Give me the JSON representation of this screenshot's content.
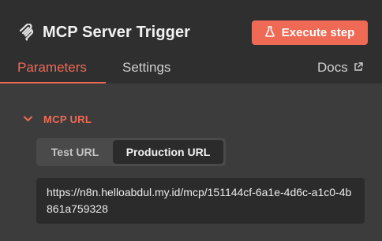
{
  "node": {
    "title": "MCP Server Trigger",
    "icon": "mcp-plug-icon"
  },
  "actions": {
    "execute_label": "Execute step",
    "execute_icon": "flask-icon"
  },
  "tabs": [
    {
      "label": "Parameters",
      "active": true
    },
    {
      "label": "Settings",
      "active": false
    }
  ],
  "docs": {
    "label": "Docs",
    "icon": "external-link-icon"
  },
  "mcp_url_section": {
    "title": "MCP URL",
    "expanded": true,
    "toggle": {
      "options": [
        "Test URL",
        "Production URL"
      ],
      "selected": "Production URL"
    },
    "url": "https://n8n.helloabdul.my.id/mcp/151144cf-6a1e-4d6c-a1c0-4b861a759328"
  },
  "colors": {
    "accent": "#ef6a55",
    "header_bg": "#2f2f2f",
    "panel_bg": "#3c3c3c",
    "field_bg": "#2b2b2b"
  }
}
